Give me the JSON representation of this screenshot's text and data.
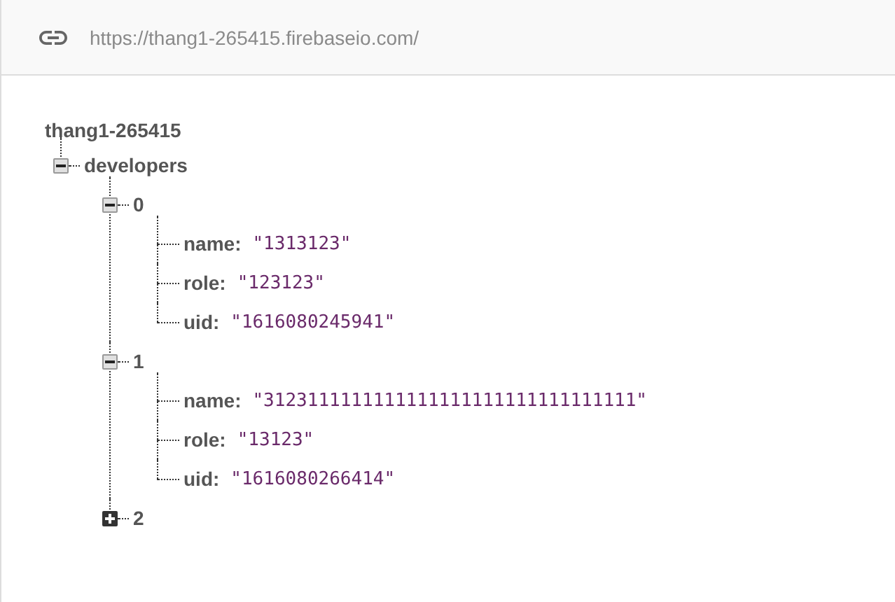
{
  "header": {
    "url": "https://thang1-265415.firebaseio.com/"
  },
  "root": {
    "key": "thang1-265415",
    "children": [
      {
        "kind": "branch",
        "key": "developers",
        "expanded": true,
        "children": [
          {
            "kind": "branch",
            "key": "0",
            "expanded": true,
            "children": [
              {
                "kind": "leaf",
                "key": "name:",
                "value": "\"1313123\""
              },
              {
                "kind": "leaf",
                "key": "role:",
                "value": "\"123123\""
              },
              {
                "kind": "leaf",
                "key": "uid:",
                "value": "\"1616080245941\""
              }
            ]
          },
          {
            "kind": "branch",
            "key": "1",
            "expanded": true,
            "children": [
              {
                "kind": "leaf",
                "key": "name:",
                "value": "\"3123111111111111111111111111111111\""
              },
              {
                "kind": "leaf",
                "key": "role:",
                "value": "\"13123\""
              },
              {
                "kind": "leaf",
                "key": "uid:",
                "value": "\"1616080266414\""
              }
            ]
          },
          {
            "kind": "branch",
            "key": "2",
            "expanded": false
          }
        ]
      }
    ]
  }
}
